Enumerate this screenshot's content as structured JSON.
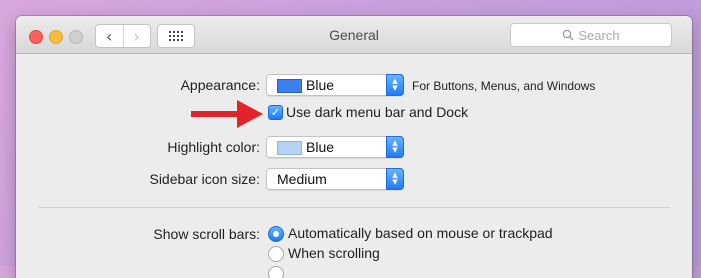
{
  "window": {
    "title": "General",
    "search_placeholder": "Search",
    "nav_back": "‹",
    "nav_forward": "›"
  },
  "appearance": {
    "label": "Appearance:",
    "value": "Blue",
    "swatch_color": "#3b7ff0",
    "hint": "For Buttons, Menus, and Windows"
  },
  "dark_menu": {
    "label": "Use dark menu bar and Dock",
    "checked": true
  },
  "highlight": {
    "label": "Highlight color:",
    "value": "Blue",
    "swatch_color": "#b7d2f5"
  },
  "sidebar_icon_size": {
    "label": "Sidebar icon size:",
    "value": "Medium"
  },
  "scroll_bars": {
    "label": "Show scroll bars:",
    "options": [
      {
        "label": "Automatically based on mouse or trackpad",
        "selected": true
      },
      {
        "label": "When scrolling",
        "selected": false
      }
    ]
  },
  "colors": {
    "accent": "#1d7cf2",
    "annotation_arrow": "#e2232a"
  }
}
